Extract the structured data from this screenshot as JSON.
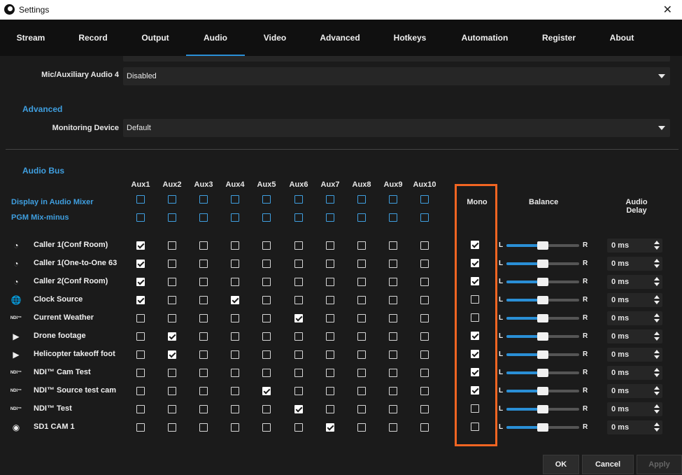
{
  "window": {
    "title": "Settings"
  },
  "tabs": [
    {
      "label": "Stream",
      "active": false
    },
    {
      "label": "Record",
      "active": false
    },
    {
      "label": "Output",
      "active": false
    },
    {
      "label": "Audio",
      "active": true
    },
    {
      "label": "Video",
      "active": false
    },
    {
      "label": "Advanced",
      "active": false
    },
    {
      "label": "Hotkeys",
      "active": false
    },
    {
      "label": "Automation",
      "active": false
    },
    {
      "label": "Register",
      "active": false
    },
    {
      "label": "About",
      "active": false
    }
  ],
  "mic_aux4": {
    "label": "Mic/Auxiliary Audio 4",
    "value": "Disabled"
  },
  "advanced": {
    "section_title": "Advanced",
    "monitoring_label": "Monitoring Device",
    "monitoring_value": "Default"
  },
  "audio_bus": {
    "section_title": "Audio Bus",
    "aux_headers": [
      "Aux1",
      "Aux2",
      "Aux3",
      "Aux4",
      "Aux5",
      "Aux6",
      "Aux7",
      "Aux8",
      "Aux9",
      "Aux10"
    ],
    "display_in_mixer_label": "Display in Audio Mixer",
    "pgm_mix_minus_label": "PGM Mix-minus",
    "mono_header": "Mono",
    "balance_header": "Balance",
    "delay_header": "Audio Delay",
    "balance_left": "L",
    "balance_right": "R",
    "ndi_icon_text": "NDI™",
    "sources": [
      {
        "name": "Caller 1(Conf Room)",
        "icon": "caller-icon",
        "aux": [
          1,
          0,
          0,
          0,
          0,
          0,
          0,
          0,
          0,
          0
        ],
        "mono": true,
        "balance": 0.5,
        "delay": "0 ms"
      },
      {
        "name": "Caller 1(One-to-One 63",
        "icon": "caller-icon",
        "aux": [
          1,
          0,
          0,
          0,
          0,
          0,
          0,
          0,
          0,
          0
        ],
        "mono": true,
        "balance": 0.5,
        "delay": "0 ms"
      },
      {
        "name": "Caller 2(Conf Room)",
        "icon": "caller-icon",
        "aux": [
          1,
          0,
          0,
          0,
          0,
          0,
          0,
          0,
          0,
          0
        ],
        "mono": true,
        "balance": 0.5,
        "delay": "0 ms"
      },
      {
        "name": "Clock Source",
        "icon": "globe-icon",
        "aux": [
          1,
          0,
          0,
          1,
          0,
          0,
          0,
          0,
          0,
          0
        ],
        "mono": false,
        "balance": 0.5,
        "delay": "0 ms"
      },
      {
        "name": "Current Weather",
        "icon": "ndi-icon",
        "aux": [
          0,
          0,
          0,
          0,
          0,
          1,
          0,
          0,
          0,
          0
        ],
        "mono": false,
        "balance": 0.5,
        "delay": "0 ms"
      },
      {
        "name": "Drone footage",
        "icon": "play-icon",
        "aux": [
          0,
          1,
          0,
          0,
          0,
          0,
          0,
          0,
          0,
          0
        ],
        "mono": true,
        "balance": 0.5,
        "delay": "0 ms"
      },
      {
        "name": "Helicopter takeoff foot",
        "icon": "play-icon",
        "aux": [
          0,
          1,
          0,
          0,
          0,
          0,
          0,
          0,
          0,
          0
        ],
        "mono": true,
        "balance": 0.5,
        "delay": "0 ms"
      },
      {
        "name": "NDI™ Cam Test",
        "icon": "ndi-icon",
        "aux": [
          0,
          0,
          0,
          0,
          0,
          0,
          0,
          0,
          0,
          0
        ],
        "mono": true,
        "balance": 0.5,
        "delay": "0 ms"
      },
      {
        "name": "NDI™ Source test cam",
        "icon": "ndi-icon",
        "aux": [
          0,
          0,
          0,
          0,
          1,
          0,
          0,
          0,
          0,
          0
        ],
        "mono": true,
        "balance": 0.5,
        "delay": "0 ms"
      },
      {
        "name": "NDI™ Test",
        "icon": "ndi-icon",
        "aux": [
          0,
          0,
          0,
          0,
          0,
          1,
          0,
          0,
          0,
          0
        ],
        "mono": false,
        "balance": 0.5,
        "delay": "0 ms"
      },
      {
        "name": "SD1 CAM 1",
        "icon": "eye-icon",
        "aux": [
          0,
          0,
          0,
          0,
          0,
          0,
          1,
          0,
          0,
          0
        ],
        "mono": false,
        "balance": 0.5,
        "delay": "0 ms"
      }
    ]
  },
  "buttons": {
    "ok": "OK",
    "cancel": "Cancel",
    "apply": "Apply"
  },
  "colors": {
    "accent": "#2a8fd6",
    "highlight": "#f26522",
    "section": "#3f9fe0"
  }
}
